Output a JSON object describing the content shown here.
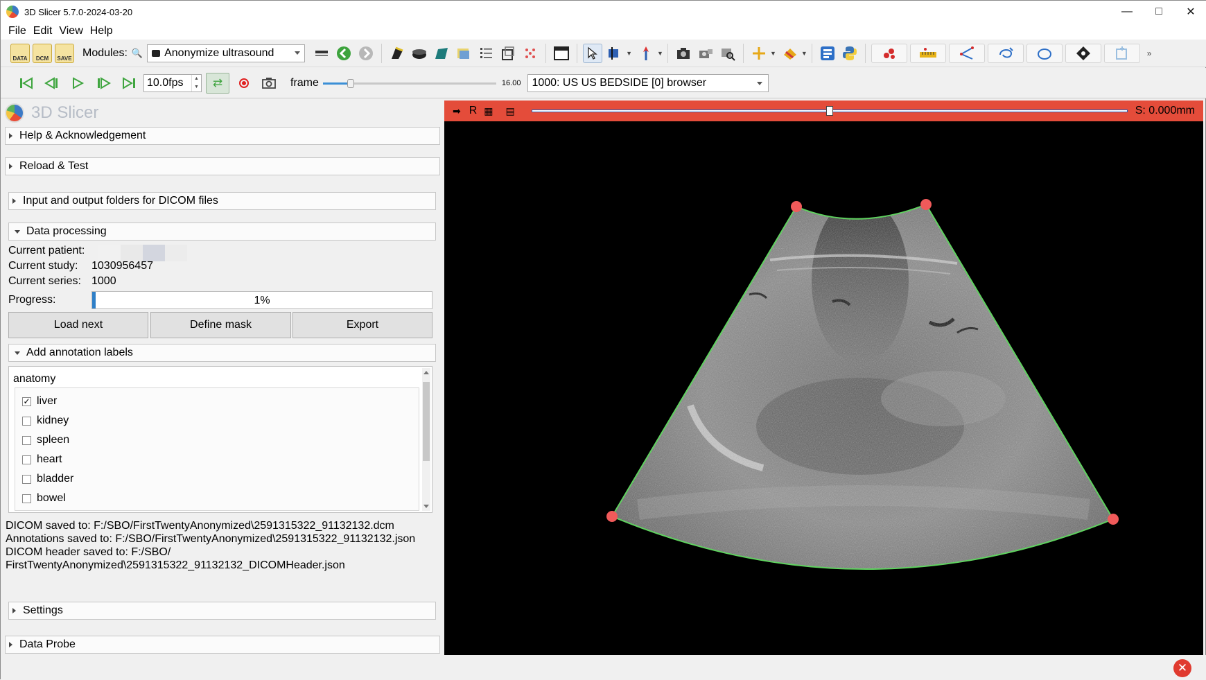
{
  "window": {
    "title": "3D Slicer 5.7.0-2024-03-20",
    "controls": [
      "—",
      "□",
      "✕"
    ]
  },
  "menu": [
    "File",
    "Edit",
    "View",
    "Help"
  ],
  "toolbar": {
    "data_label": "DATA",
    "dcm_label": "DCM",
    "save_label": "SAVE",
    "modules_label": "Modules:",
    "module_selected": "Anonymize ultrasound"
  },
  "sequence": {
    "fps": "10.0fps",
    "frame_label": "frame",
    "frame_progress": 0.14,
    "frame_max": "16.00",
    "browser": "1000: US US BEDSIDE [0] browser"
  },
  "panel": {
    "brand": "3D Slicer",
    "sections": {
      "help": "Help & Acknowledgement",
      "reload": "Reload & Test",
      "io": "Input and output folders for DICOM files",
      "processing": "Data processing",
      "annotation": "Add annotation labels",
      "settings": "Settings",
      "probe": "Data Probe"
    },
    "patient_label": "Current patient:",
    "study_label": "Current study:",
    "study_value": "1030956457",
    "series_label": "Current series:",
    "series_value": "1000",
    "progress_label": "Progress:",
    "progress_text": "1%",
    "progress_value": 0.01,
    "buttons": {
      "load_next": "Load next",
      "define_mask": "Define mask",
      "export": "Export"
    },
    "label_category": "anatomy",
    "labels": [
      {
        "name": "liver",
        "checked": true,
        "mark": "✓"
      },
      {
        "name": "kidney",
        "checked": false,
        "mark": ""
      },
      {
        "name": "spleen",
        "checked": false,
        "mark": ""
      },
      {
        "name": "heart",
        "checked": false,
        "mark": ""
      },
      {
        "name": "bladder",
        "checked": false,
        "mark": ""
      },
      {
        "name": "bowel",
        "checked": false,
        "mark": ""
      }
    ],
    "log": [
      "DICOM saved to: F:/SBO/FirstTwentyAnonymized\\2591315322_91132132.dcm",
      "Annotations saved to: F:/SBO/FirstTwentyAnonymized\\2591315322_91132132.json",
      "DICOM header saved to: F:/SBO/",
      "FirstTwentyAnonymized\\2591315322_91132132_DICOMHeader.json"
    ]
  },
  "viewer": {
    "orientation": "R",
    "offset": "S: 0.000mm",
    "slice_slider_value": 0.5,
    "bar_color": "#e44c3a",
    "mask_color": "#5fd35f",
    "point_color": "#f05a5a"
  },
  "status": {
    "error_icon": "✕"
  }
}
